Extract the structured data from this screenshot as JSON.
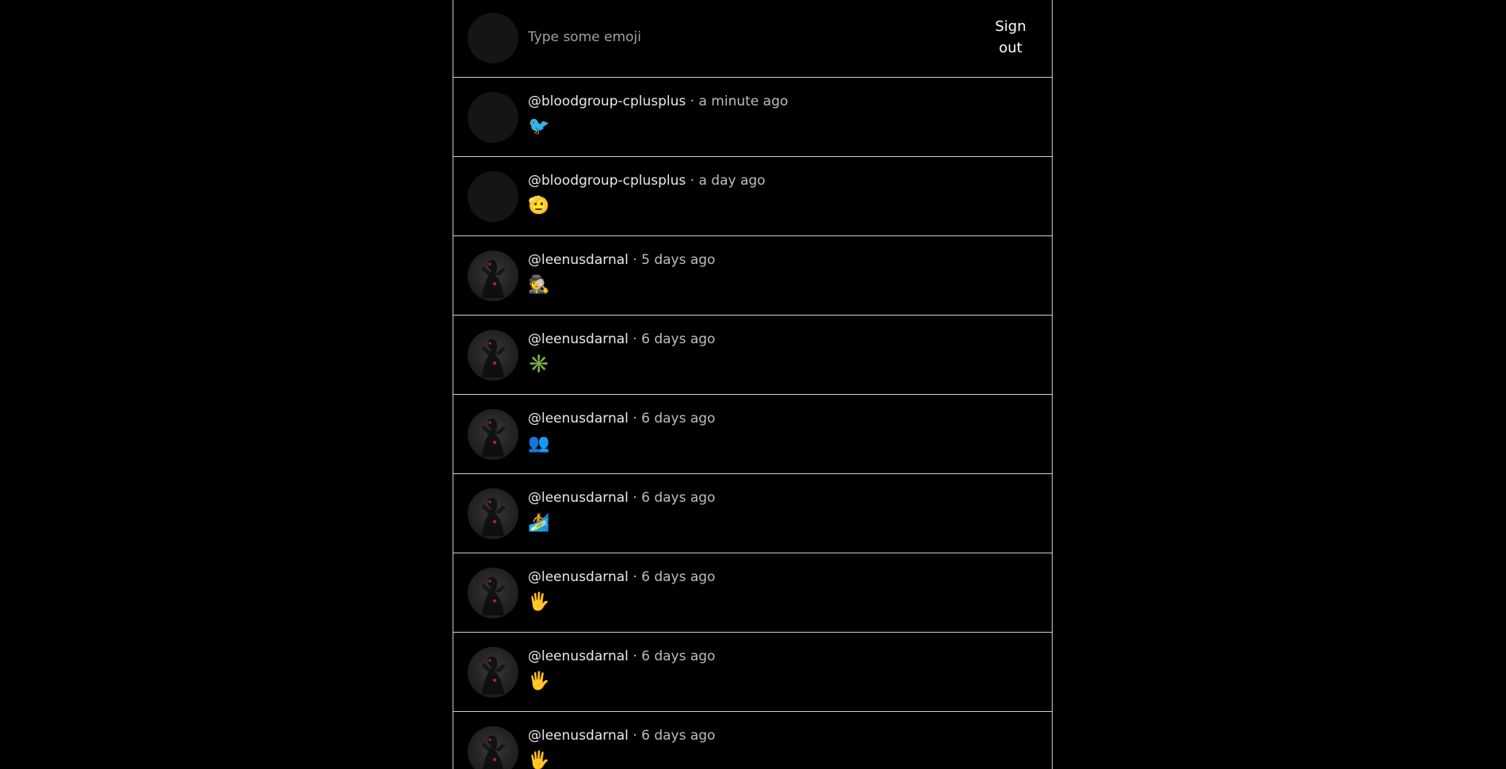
{
  "composer": {
    "placeholder": "Type some emoji",
    "signout_label": "Sign out"
  },
  "feed": {
    "separator": "·",
    "posts": [
      {
        "username": "@bloodgroup-cplusplus",
        "time": "a minute ago",
        "emoji": "🐦",
        "avatar": "blank"
      },
      {
        "username": "@bloodgroup-cplusplus",
        "time": "a day ago",
        "emoji": "🫡",
        "avatar": "blank"
      },
      {
        "username": "@leenusdarnal",
        "time": "5 days ago",
        "emoji": "🕵️",
        "avatar": "shadow-figure"
      },
      {
        "username": "@leenusdarnal",
        "time": "6 days ago",
        "emoji": "✳️",
        "avatar": "shadow-figure"
      },
      {
        "username": "@leenusdarnal",
        "time": "6 days ago",
        "emoji": "👥",
        "avatar": "shadow-figure"
      },
      {
        "username": "@leenusdarnal",
        "time": "6 days ago",
        "emoji": "🏄",
        "avatar": "shadow-figure"
      },
      {
        "username": "@leenusdarnal",
        "time": "6 days ago",
        "emoji": "🖐️",
        "avatar": "shadow-figure"
      },
      {
        "username": "@leenusdarnal",
        "time": "6 days ago",
        "emoji": "🖐️",
        "avatar": "shadow-figure"
      },
      {
        "username": "@leenusdarnal",
        "time": "6 days ago",
        "emoji": "🖐️",
        "avatar": "shadow-figure"
      }
    ]
  },
  "colors": {
    "background": "#000000",
    "border": "#cfcfcf",
    "text": "#ffffff",
    "muted": "#bdbdbd",
    "avatar_blank": "#151515",
    "avatar_eye": "#d11a1a"
  }
}
